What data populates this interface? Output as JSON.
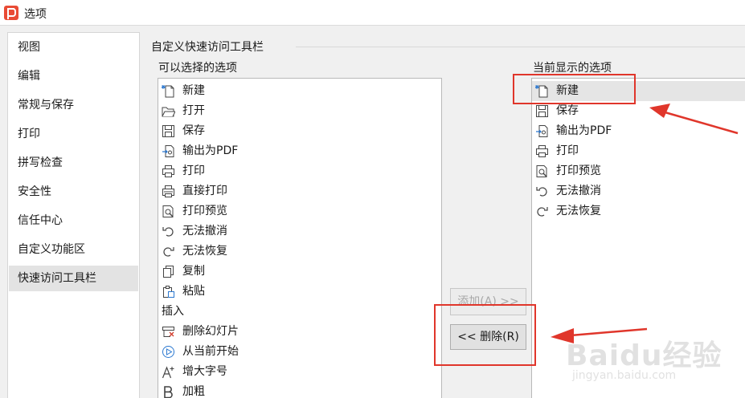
{
  "window": {
    "title": "选项",
    "app_icon": "wps-presentation-icon"
  },
  "sidebar": {
    "items": [
      {
        "label": "视图"
      },
      {
        "label": "编辑"
      },
      {
        "label": "常规与保存"
      },
      {
        "label": "打印"
      },
      {
        "label": "拼写检查"
      },
      {
        "label": "安全性"
      },
      {
        "label": "信任中心"
      },
      {
        "label": "自定义功能区"
      },
      {
        "label": "快速访问工具栏",
        "selected": true
      }
    ]
  },
  "group": {
    "title": "自定义快速访问工具栏",
    "available_caption": "可以选择的选项",
    "current_caption": "当前显示的选项"
  },
  "available_list": {
    "items": [
      {
        "label": "新建",
        "icon": "new-file-icon"
      },
      {
        "label": "打开",
        "icon": "open-folder-icon"
      },
      {
        "label": "保存",
        "icon": "save-icon"
      },
      {
        "label": "输出为PDF",
        "icon": "export-pdf-icon"
      },
      {
        "label": "打印",
        "icon": "print-icon"
      },
      {
        "label": "直接打印",
        "icon": "direct-print-icon"
      },
      {
        "label": "打印预览",
        "icon": "print-preview-icon"
      },
      {
        "label": "无法撤消",
        "icon": "undo-icon"
      },
      {
        "label": "无法恢复",
        "icon": "redo-icon"
      },
      {
        "label": "复制",
        "icon": "copy-icon"
      },
      {
        "label": "粘贴",
        "icon": "paste-icon"
      },
      {
        "label": "插入",
        "icon": "",
        "header": true
      },
      {
        "label": "删除幻灯片",
        "icon": "delete-slide-icon"
      },
      {
        "label": "从当前开始",
        "icon": "play-from-current-icon"
      },
      {
        "label": "增大字号",
        "icon": "increase-font-icon"
      },
      {
        "label": "加粗",
        "icon": "bold-icon"
      }
    ]
  },
  "current_list": {
    "items": [
      {
        "label": "新建",
        "icon": "new-file-icon",
        "selected": true
      },
      {
        "label": "保存",
        "icon": "save-icon"
      },
      {
        "label": "输出为PDF",
        "icon": "export-pdf-icon"
      },
      {
        "label": "打印",
        "icon": "print-icon"
      },
      {
        "label": "打印预览",
        "icon": "print-preview-icon"
      },
      {
        "label": "无法撤消",
        "icon": "undo-icon"
      },
      {
        "label": "无法恢复",
        "icon": "redo-icon"
      }
    ]
  },
  "buttons": {
    "add_label": "添加(A) >>",
    "add_enabled": false,
    "remove_label": "<< 删除(R)"
  },
  "annotation_color": "#e0362b",
  "watermark": {
    "brand": "Baidu经验",
    "url": "jingyan.baidu.com"
  }
}
